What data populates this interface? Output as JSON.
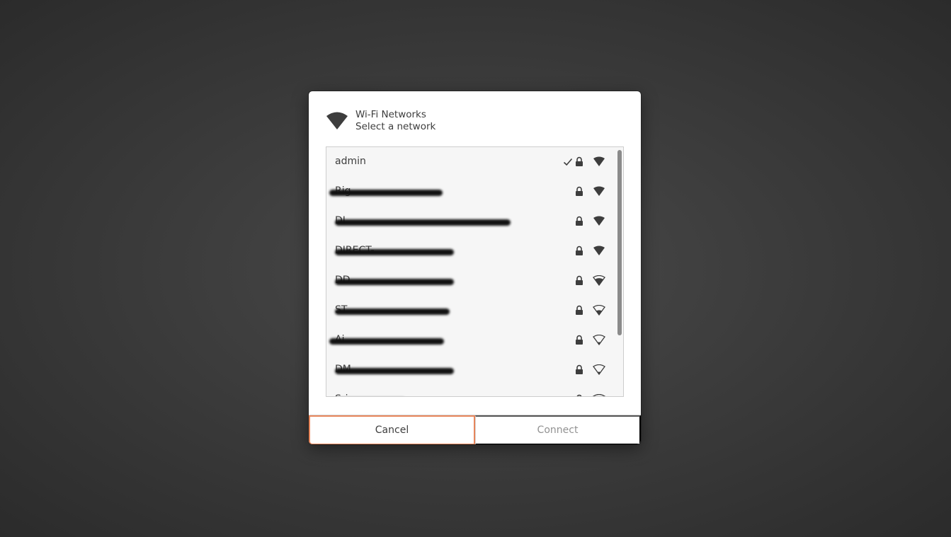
{
  "dialog": {
    "title": "Wi-Fi Networks",
    "subtitle": "Select a network",
    "icon": "wifi-icon"
  },
  "networks": [
    {
      "ssid": "admin",
      "connected": true,
      "secured": true,
      "signal": "full",
      "redacted": false
    },
    {
      "ssid": "Rig",
      "connected": false,
      "secured": true,
      "signal": "full",
      "redacted": true
    },
    {
      "ssid": "DI",
      "connected": false,
      "secured": true,
      "signal": "full",
      "redacted": true
    },
    {
      "ssid": "DIRECT-",
      "connected": false,
      "secured": true,
      "signal": "full",
      "redacted": true
    },
    {
      "ssid": "DD",
      "connected": false,
      "secured": true,
      "signal": "good",
      "redacted": true
    },
    {
      "ssid": "ST",
      "connected": false,
      "secured": true,
      "signal": "ok",
      "redacted": true
    },
    {
      "ssid": "Ai",
      "connected": false,
      "secured": true,
      "signal": "weak",
      "redacted": true
    },
    {
      "ssid": "DM",
      "connected": false,
      "secured": true,
      "signal": "weak",
      "redacted": true
    },
    {
      "ssid": "Sri",
      "connected": false,
      "secured": true,
      "signal": "weak",
      "redacted": true
    }
  ],
  "buttons": {
    "cancel": "Cancel",
    "connect": "Connect"
  },
  "colors": {
    "focus_outline": "#e7865b",
    "text": "#3d3d3d",
    "disabled_text": "#929292"
  }
}
